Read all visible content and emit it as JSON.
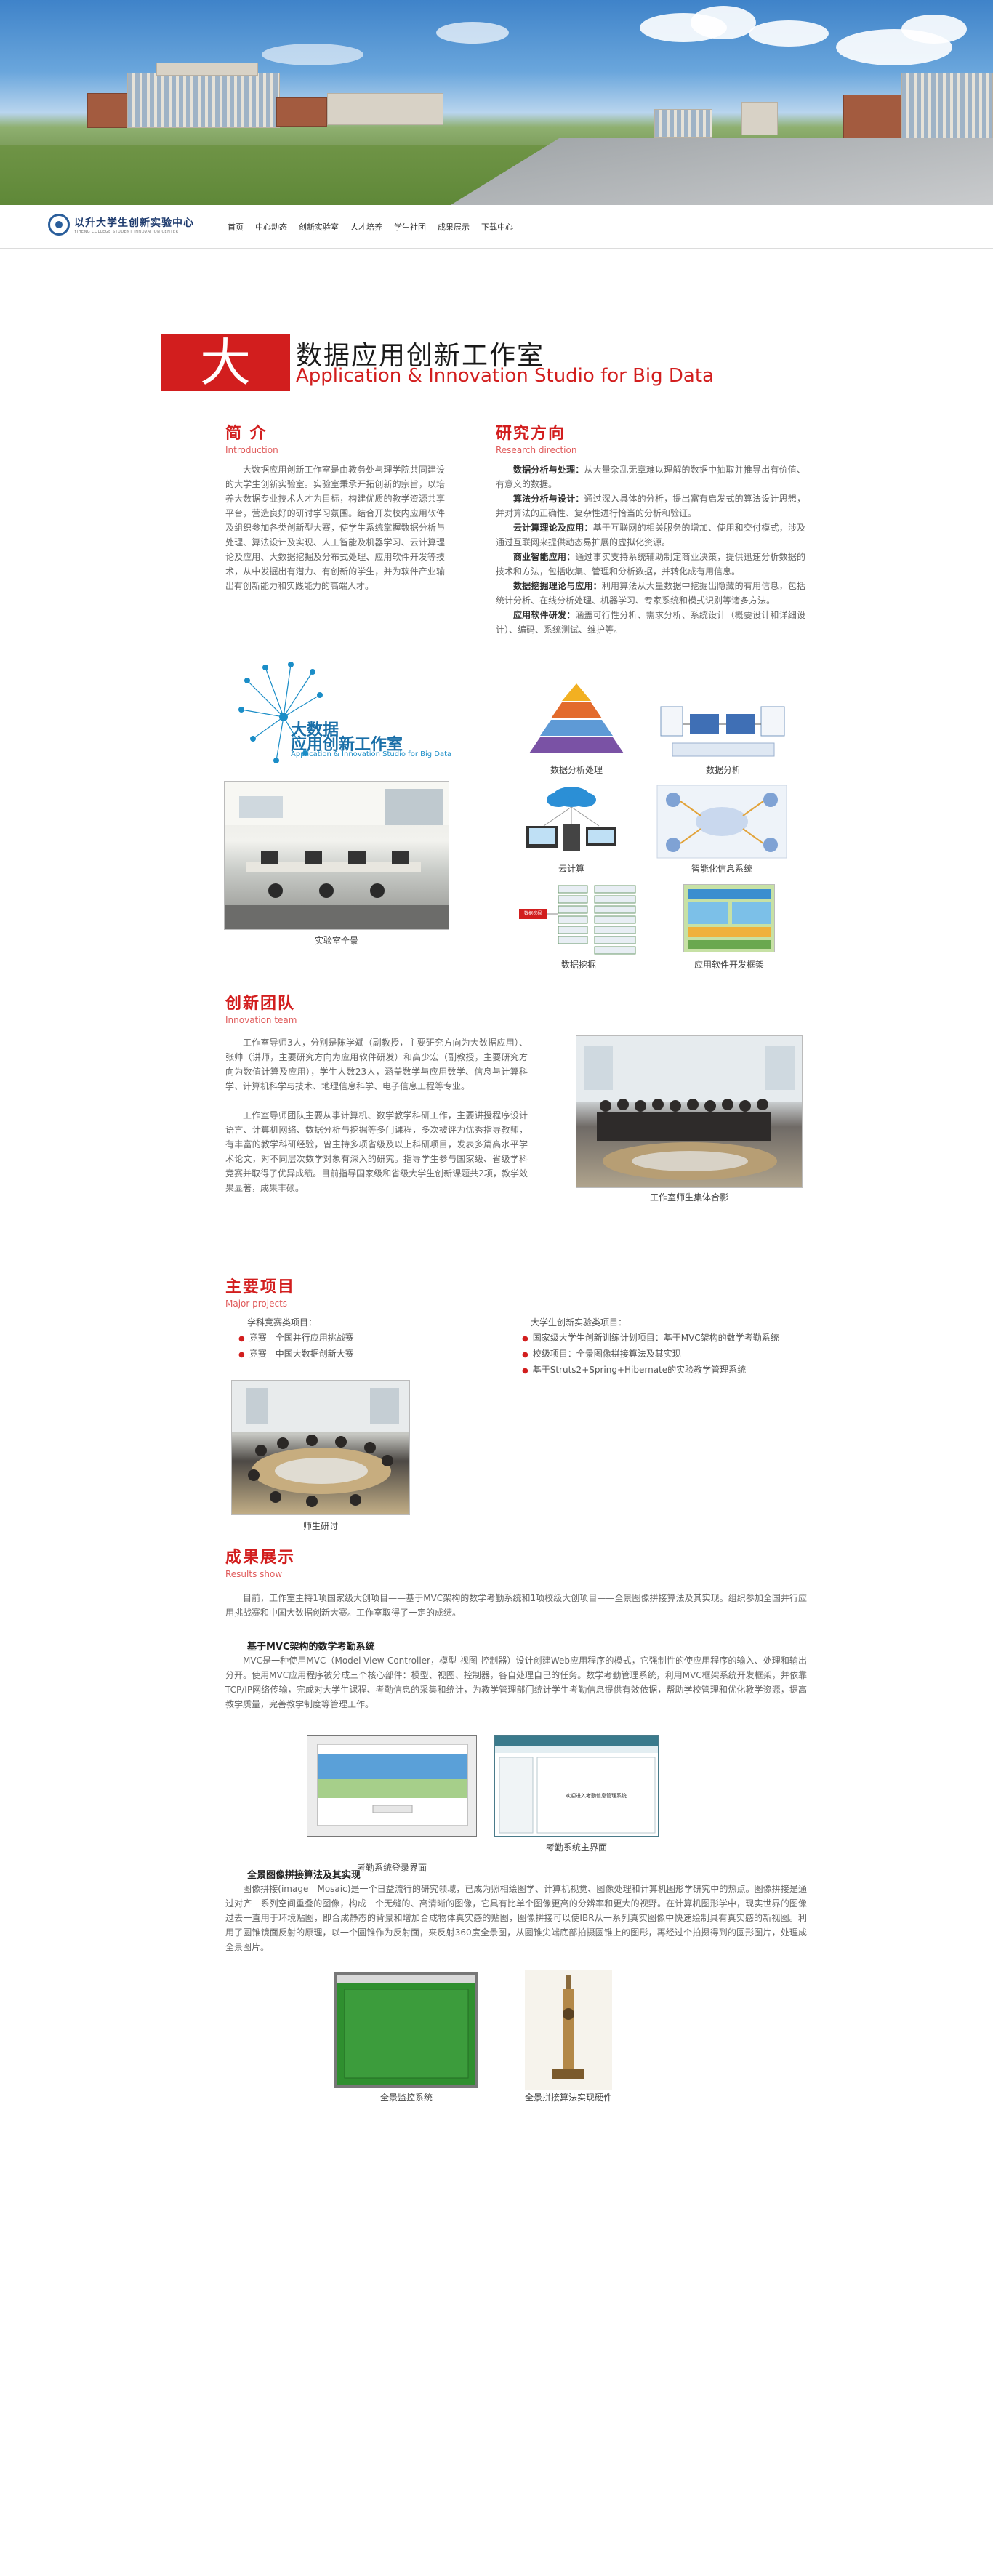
{
  "nav": {
    "logo_cn": "以升大学生创新实验中心",
    "logo_en": "YIHENG COLLEGE STUDENT INNOVATION CENTER",
    "items": [
      "首页",
      "中心动态",
      "创新实验室",
      "人才培养",
      "学生社团",
      "成果展示",
      "下载中心"
    ]
  },
  "studio": {
    "big_char": "大",
    "title_cn": "数据应用创新工作室",
    "title_en": "Application & Innovation Studio for Big Data"
  },
  "intro": {
    "heading_cn": "简 介",
    "heading_en": "Introduction",
    "text": "大数据应用创新工作室是由教务处与理学院共同建设的大学生创新实验室。实验室秉承开拓创新的宗旨，以培养大数据专业技术人才为目标，构建优质的教学资源共享平台，营造良好的研讨学习氛围。结合开发校内应用软件及组织参加各类创新型大赛，使学生系统掌握数据分析与处理、算法设计及实现、人工智能及机器学习、云计算理论及应用、大数据挖掘及分布式处理、应用软件开发等技术，从中发掘出有潜力、有创新的学生，并为软件产业输出有创新能力和实践能力的高端人才。",
    "logo_t1": "大数据",
    "logo_t2": "应用创新工作室",
    "logo_t3": "Application & Innovation Studio for Big Data",
    "photo_caption": "实验室全景"
  },
  "research": {
    "heading_cn": "研究方向",
    "heading_en": "Research direction",
    "items": [
      {
        "label": "数据分析与处理：",
        "text": "从大量杂乱无章难以理解的数据中抽取并推导出有价值、有意义的数据。"
      },
      {
        "label": "算法分析与设计：",
        "text": "通过深入具体的分析，提出富有启发式的算法设计思想，并对算法的正确性、复杂性进行恰当的分析和验证。"
      },
      {
        "label": "云计算理论及应用：",
        "text": "基于互联网的相关服务的增加、使用和交付模式，涉及通过互联网来提供动态易扩展的虚拟化资源。"
      },
      {
        "label": "商业智能应用：",
        "text": "通过事实支持系统辅助制定商业决策，提供迅速分析数据的技术和方法，包括收集、管理和分析数据，并转化成有用信息。"
      },
      {
        "label": "数据挖掘理论与应用：",
        "text": "利用算法从大量数据中挖掘出隐藏的有用信息，包括统计分析、在线分析处理、机器学习、专家系统和模式识别等诸多方法。"
      },
      {
        "label": "应用软件研发：",
        "text": "涵盖可行性分析、需求分析、系统设计（概要设计和详细设计）、编码、系统测试、维护等。"
      }
    ],
    "captions": [
      "数据分析处理",
      "数据分析",
      "云计算",
      "智能化信息系统",
      "数据挖掘",
      "应用软件开发框架"
    ],
    "pyramid_tag": "数据挖掘"
  },
  "team": {
    "heading_cn": "创新团队",
    "heading_en": "Innovation team",
    "p1": "工作室导师3人，分别是陈学斌（副教授，主要研究方向为大数据应用）、张帅（讲师，主要研究方向为应用软件研发）和高少宏（副教授，主要研究方向为数值计算及应用），学生人数23人，涵盖数学与应用数学、信息与计算科学、计算机科学与技术、地理信息科学、电子信息工程等专业。",
    "p2": "工作室导师团队主要从事计算机、数学教学科研工作，主要讲授程序设计语言、计算机网络、数据分析与挖掘等多门课程，多次被评为优秀指导教师，有丰富的教学科研经验，曾主持多项省级及以上科研项目，发表多篇高水平学术论文，对不同层次数学对象有深入的研究。指导学生参与国家级、省级学科竞赛并取得了优异成绩。目前指导国家级和省级大学生创新课题共2项，教学效果显著，成果丰硕。",
    "photo_caption": "工作室师生集体合影"
  },
  "projects": {
    "heading_cn": "主要项目",
    "heading_en": "Major projects",
    "left_title": "学科竞赛类项目：",
    "left_items": [
      "竞赛　全国并行应用挑战赛",
      "竞赛　中国大数据创新大赛"
    ],
    "right_title": "大学生创新实验类项目：",
    "right_items": [
      "国家级大学生创新训练计划项目：基于MVC架构的数学考勤系统",
      "校级项目：全景图像拼接算法及其实现",
      "基于Struts2+Spring+Hibernate的实验教学管理系统"
    ],
    "photo_caption": "师生研讨"
  },
  "results": {
    "heading_cn": "成果展示",
    "heading_en": "Results show",
    "intro": "目前，工作室主持1项国家级大创项目——基于MVC架构的数学考勤系统和1项校级大创项目——全景图像拼接算法及其实现。组织参加全国并行应用挑战赛和中国大数据创新大赛。工作室取得了一定的成绩。",
    "mvc_title": "基于MVC架构的数学考勤系统",
    "mvc_text": "MVC是一种使用MVC（Model-View-Controller，模型-视图-控制器）设计创建Web应用程序的模式，它强制性的使应用程序的输入、处理和输出分开。使用MVC应用程序被分成三个核心部件：模型、视图、控制器，各自处理自己的任务。数学考勤管理系统，利用MVC框架系统开发框架，并依靠TCP/IP网络传输，完成对大学生课程、考勤信息的采集和统计，为教学管理部门统计学生考勤信息提供有效依据，帮助学校管理和优化教学资源，提高教学质量，完善教学制度等管理工作。",
    "cap_login": "考勤系统登录界面",
    "cap_main": "考勤系统主界面",
    "screen_text": "欢迎进入考勤信息管理系统",
    "pano_title": "全景图像拼接算法及其实现",
    "pano_text": "图像拼接(image　Mosaic)是一个日益流行的研究领域，已成为照相绘图学、计算机视觉、图像处理和计算机图形学研究中的热点。图像拼接是通过对齐一系列空间重叠的图像，构成一个无缝的、高清晰的图像，它具有比单个图像更高的分辨率和更大的视野。在计算机图形学中，现实世界的图像过去一直用于环境贴图，即合成静态的背景和增加合成物体真实感的贴图，图像拼接可以使IBR从一系列真实图像中快速绘制具有真实感的新视图。利用了圆锥镜面反射的原理，以一个圆锥作为反射面，来反射360度全景图，从圆锥尖端底部拍摄圆锥上的图形，再经过个拍摄得到的圆形图片，处理成全景图片。",
    "cap_monitor": "全景监控系统",
    "cap_hw": "全景拼接算法实现硬件"
  },
  "colors": {
    "accent": "#d21e1e",
    "nav_text": "#333333",
    "body_text": "#666666"
  }
}
